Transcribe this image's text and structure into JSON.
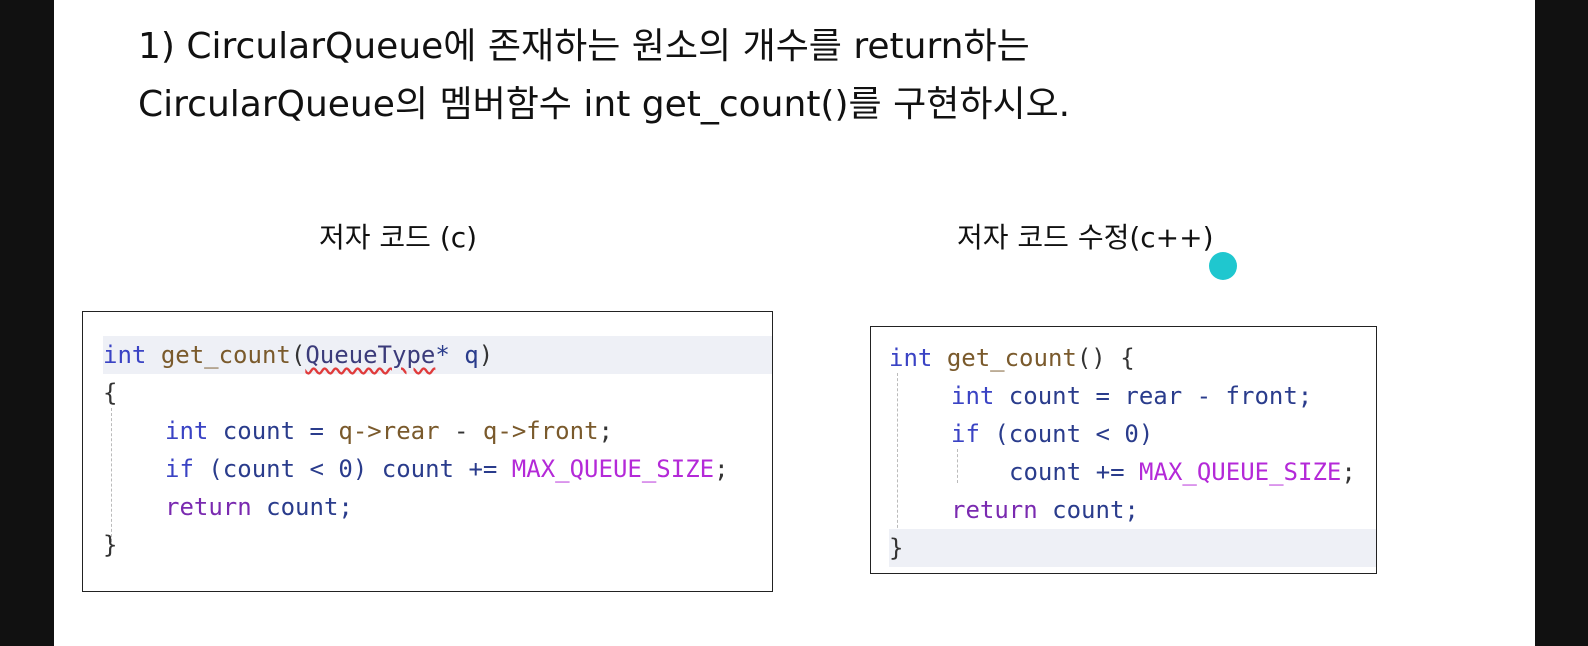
{
  "title": {
    "line1": "1) CircularQueue에 존재하는 원소의 개수를 return하는",
    "line2": "CircularQueue의 멤버함수 int get_count()를 구현하시오."
  },
  "captions": {
    "left": "저자 코드 (c)",
    "right": "저자 코드 수정(c++)"
  },
  "left_code": {
    "l1": {
      "kw": "int",
      "fn": "get_count",
      "p1": "(",
      "param_type": "QueueType",
      "param_rest": "* q",
      ")": ")"
    },
    "l2": "{",
    "l3": {
      "kw": "int",
      "rest1": " count = ",
      "ptr1": "q->rear",
      "minus": " - ",
      "ptr2": "q->front",
      "semi": ";"
    },
    "l4": {
      "kw": "if",
      "cond": " (count < 0) ",
      "rest": "count += ",
      "macro": "MAX_QUEUE_SIZE",
      "semi": ";"
    },
    "l5": {
      "kw": "return",
      "rest": " count;"
    },
    "l6": "}"
  },
  "right_code": {
    "l1": {
      "kw": "int",
      "fn": "get_count",
      "rest": "() {"
    },
    "l2": {
      "kw": "int",
      "rest": " count = rear - front;"
    },
    "l3": {
      "kw": "if",
      "rest": " (count < 0)"
    },
    "l4": {
      "rest": "count += ",
      "macro": "MAX_QUEUE_SIZE",
      "semi": ";"
    },
    "l5": {
      "kw": "return",
      "rest": " count;"
    },
    "l6": "}"
  },
  "colors": {
    "accent_dot": "#1fc7cf",
    "keyword": "#3a43c4",
    "macro": "#b429d8"
  }
}
